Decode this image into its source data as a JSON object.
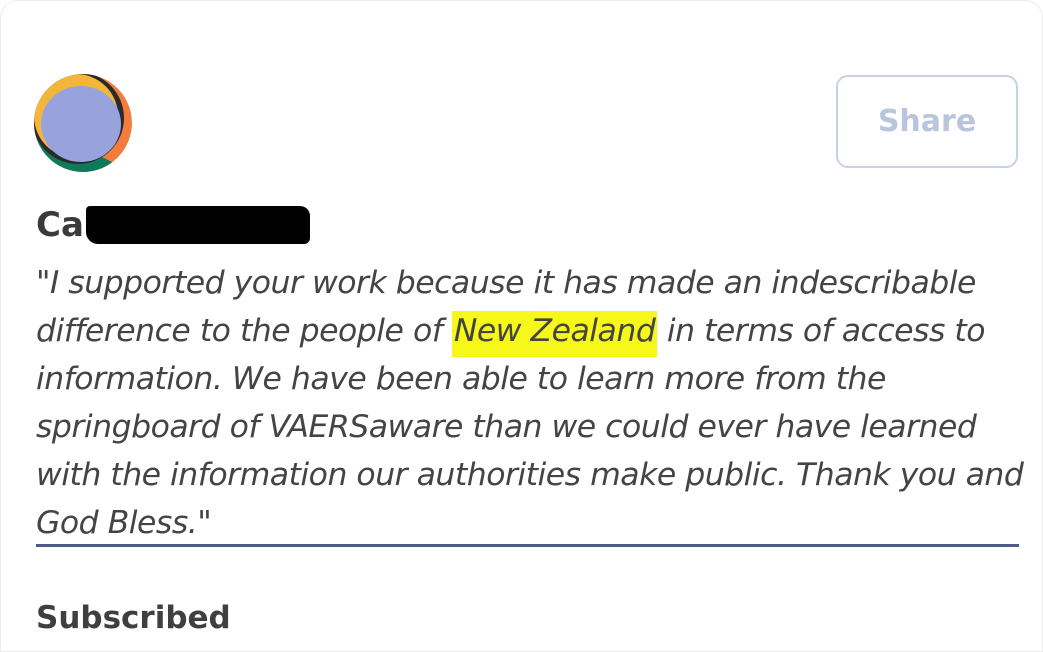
{
  "supporter": {
    "name_visible": "Ca",
    "quote_before": "\"I supported your work because it has made an indescribable difference to the people of ",
    "quote_highlight": "New Zealand",
    "quote_after": " in terms of access to information. We have been able to learn more from the springboard of VAERSaware than we could ever have learned with the information our authorities make public. Thank you and God Bless.\""
  },
  "actions": {
    "share_label": "Share"
  },
  "status": {
    "label": "Subscribed"
  },
  "colors": {
    "highlight": "#f7f71a",
    "divider": "#4b5d86",
    "share_border": "#c7d0e6",
    "avatar_main": "#98a2dc",
    "avatar_orange": "#f47c3c",
    "avatar_green": "#0f7a5a",
    "avatar_yellow": "#f4b63a"
  },
  "icons": {
    "avatar": "avatar-icon"
  }
}
